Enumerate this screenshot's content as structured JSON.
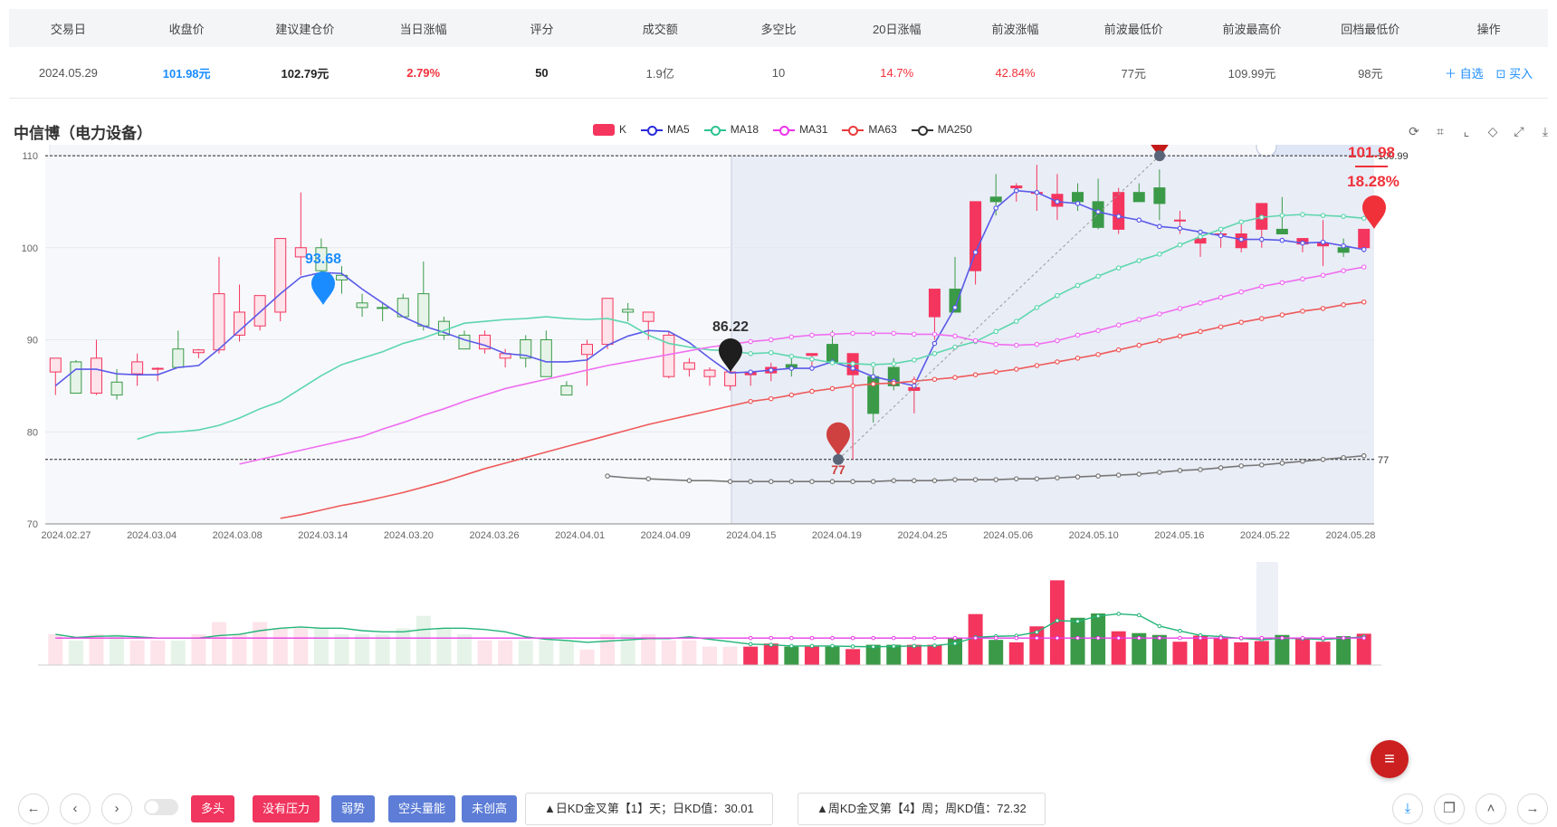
{
  "table": {
    "headers": [
      "交易日",
      "收盘价",
      "建议建仓价",
      "当日涨幅",
      "评分",
      "成交额",
      "多空比",
      "20日涨幅",
      "前波涨幅",
      "前波最低价",
      "前波最高价",
      "回档最低价",
      "操作"
    ],
    "row": [
      "2024.05.29",
      "101.98元",
      "102.79元",
      "2.79%",
      "50",
      "1.9亿",
      "10",
      "14.7%",
      "42.84%",
      "77元",
      "109.99元",
      "98元"
    ],
    "actions": {
      "watch": "＋ 自选",
      "buy": "买入"
    }
  },
  "chart": {
    "title": "中信博（电力设备）",
    "legend": [
      {
        "name": "K",
        "color": "#f4355e"
      },
      {
        "name": "MA5",
        "color": "#2b2bd9"
      },
      {
        "name": "MA18",
        "color": "#2dc391"
      },
      {
        "name": "MA31",
        "color": "#ee33ee"
      },
      {
        "name": "MA63",
        "color": "#e83b3b"
      },
      {
        "name": "MA250",
        "color": "#333333"
      }
    ],
    "tools": [
      "refresh-icon",
      "zoom-select-icon",
      "zoom-reset-icon",
      "restore-icon",
      "fullscreen-icon",
      "save-image-icon"
    ]
  },
  "chart_data": {
    "type": "candlestick",
    "title": "中信博（电力设备）",
    "ylim": [
      70,
      110
    ],
    "y_ticks": [
      "110",
      "100",
      "90",
      "80",
      "70"
    ],
    "x_ticks": [
      "2024.02.27",
      "2024.03.04",
      "2024.03.08",
      "2024.03.14",
      "2024.03.20",
      "2024.03.26",
      "2024.04.01",
      "2024.04.09",
      "2024.04.15",
      "2024.04.19",
      "2024.04.25",
      "2024.05.06",
      "2024.05.10",
      "2024.05.16",
      "2024.05.22",
      "2024.05.28"
    ],
    "annotations": {
      "high_marker": "109.99",
      "low_marker": "77",
      "marker_a": "93.68",
      "marker_b": "86.22",
      "last_price": "101.98",
      "last_change": "18.28%",
      "right_high_label": "109.99",
      "right_low_label": "77"
    },
    "candles_ohlc": [
      [
        86.5,
        88,
        84,
        88
      ],
      [
        87.6,
        87.8,
        85,
        84.2
      ],
      [
        84.2,
        90,
        84,
        88
      ],
      [
        85.4,
        86.8,
        83.5,
        84
      ],
      [
        86.3,
        88.5,
        85,
        87.6
      ],
      [
        86.8,
        87,
        85.5,
        86.9
      ],
      [
        89,
        91,
        87.5,
        87
      ],
      [
        88.6,
        89,
        88,
        88.9
      ],
      [
        88.9,
        99,
        88.5,
        95
      ],
      [
        90.5,
        96,
        89.8,
        93
      ],
      [
        91.5,
        94,
        91,
        94.8
      ],
      [
        93,
        101,
        92,
        101
      ],
      [
        99,
        106,
        97,
        100
      ],
      [
        100,
        101,
        97,
        97.5
      ],
      [
        97,
        98,
        95,
        96.5
      ],
      [
        94,
        95,
        92.5,
        93.5
      ],
      [
        93.5,
        94,
        92,
        93.4
      ],
      [
        94.5,
        95,
        93,
        92.5
      ],
      [
        95,
        98.5,
        91,
        91.5
      ],
      [
        92,
        92.5,
        90,
        90.5
      ],
      [
        90.5,
        91,
        89,
        89
      ],
      [
        89,
        91,
        88.5,
        90.5
      ],
      [
        88,
        89,
        87,
        88.5
      ],
      [
        90,
        90.5,
        87,
        88
      ],
      [
        90,
        91,
        87.5,
        86
      ],
      [
        85,
        85.5,
        84,
        84
      ],
      [
        88.4,
        90,
        85,
        89.5
      ],
      [
        89.5,
        94,
        89,
        94.5
      ],
      [
        93.3,
        94,
        92,
        93
      ],
      [
        92,
        93,
        90,
        93
      ],
      [
        86,
        91,
        85.8,
        90.5
      ],
      [
        86.8,
        88,
        86,
        87.5
      ],
      [
        86,
        87,
        85,
        86.7
      ],
      [
        85,
        87.5,
        84.5,
        86.5
      ],
      [
        86.2,
        86.5,
        85,
        86.5
      ],
      [
        86.4,
        87.5,
        85.5,
        87
      ],
      [
        87.3,
        88,
        86,
        87
      ],
      [
        88.3,
        88.5,
        87,
        88.5
      ],
      [
        89.5,
        91,
        88.5,
        87.5
      ],
      [
        86.2,
        88,
        77,
        88.5
      ],
      [
        86,
        87,
        81,
        82
      ],
      [
        87,
        88,
        84.5,
        85
      ],
      [
        84.5,
        86,
        82,
        84.8
      ],
      [
        92.5,
        95,
        90,
        95.5
      ],
      [
        95.5,
        99,
        94,
        93
      ],
      [
        97.5,
        105,
        96,
        105
      ],
      [
        105.5,
        108,
        103.5,
        105
      ],
      [
        106.5,
        107,
        105,
        106.7
      ],
      [
        106,
        109,
        104,
        106
      ],
      [
        104.5,
        108,
        103,
        105.8
      ],
      [
        106,
        107,
        104,
        105
      ],
      [
        105,
        107.5,
        102,
        102.2
      ],
      [
        102,
        106.5,
        101.5,
        106
      ],
      [
        106,
        107,
        105,
        105
      ],
      [
        106.5,
        108.5,
        103,
        104.8
      ],
      [
        103,
        104,
        101.5,
        103
      ],
      [
        100.5,
        101,
        99,
        101
      ],
      [
        101.5,
        102,
        100,
        101.5
      ],
      [
        100,
        102.5,
        99.5,
        101.5
      ],
      [
        102,
        104.5,
        100,
        104.8
      ],
      [
        102,
        105.5,
        101.5,
        101.5
      ],
      [
        100.4,
        101,
        99.5,
        101
      ],
      [
        100.2,
        103,
        98,
        100.5
      ],
      [
        100,
        101,
        99,
        99.5
      ],
      [
        100,
        102,
        99.5,
        102
      ]
    ],
    "series": [
      {
        "name": "MA5",
        "values": [
          85,
          86.8,
          86.8,
          86.3,
          86.2,
          86.2,
          87,
          87.2,
          89,
          91,
          93,
          95,
          96.8,
          97.3,
          97.2,
          95.5,
          94,
          92.5,
          91.5,
          90.8,
          90,
          89.4,
          88.5,
          88.3,
          87.6,
          87.6,
          87.8,
          89.4,
          90.4,
          91,
          90.9,
          89.7,
          88,
          86.4,
          86.5,
          86.7,
          86.9,
          86.9,
          87.6,
          86.9,
          86,
          85.5,
          85,
          89.6,
          93.5,
          99.5,
          104.3,
          106.2,
          106,
          105,
          104.8,
          103.9,
          103.4,
          103,
          102.3,
          102.1,
          101.7,
          101.3,
          100.9,
          100.9,
          100.8,
          100.5,
          100.6,
          100.2,
          99.8
        ]
      },
      {
        "name": "MA18",
        "values": [
          79.2,
          79.9,
          80,
          80.2,
          80.7,
          81.5,
          82.5,
          83.3,
          84.7,
          86.1,
          87.3,
          88,
          88.7,
          89.6,
          90.2,
          91,
          91.8,
          92,
          92.2,
          92.3,
          92.5,
          92.3,
          92.2,
          92.3,
          91.8,
          90.5,
          89.6,
          89.2,
          88.9,
          88.8,
          88.5,
          88.6,
          88.2,
          87.9,
          87.5,
          87.4,
          87.3,
          87.4,
          87.8,
          88.5,
          89.2,
          89.8,
          90.9,
          92,
          93.5,
          94.8,
          95.9,
          96.9,
          97.8,
          98.6,
          99.3,
          100.3,
          101.2,
          102,
          102.8,
          103.3,
          103.5,
          103.6,
          103.5,
          103.4,
          103.2
        ]
      },
      {
        "name": "MA31",
        "values": [
          76.5,
          77,
          77.5,
          78,
          78.5,
          79,
          79.5,
          80.3,
          81,
          81.8,
          82.5,
          83.3,
          84,
          84.7,
          85.2,
          85.7,
          86.2,
          86.7,
          87.2,
          87.6,
          88,
          88.4,
          88.8,
          89.2,
          89.5,
          89.8,
          90,
          90.3,
          90.5,
          90.6,
          90.7,
          90.7,
          90.7,
          90.6,
          90.6,
          90.4,
          89.9,
          89.5,
          89.4,
          89.5,
          89.9,
          90.5,
          91,
          91.6,
          92.2,
          92.8,
          93.4,
          94,
          94.6,
          95.2,
          95.8,
          96.2,
          96.6,
          97,
          97.5,
          97.9
        ]
      },
      {
        "name": "MA63",
        "values": [
          70.6,
          71,
          71.5,
          72,
          72.4,
          72.9,
          73.4,
          74,
          74.6,
          75.3,
          76,
          76.6,
          77.2,
          77.8,
          78.4,
          79,
          79.6,
          80.2,
          80.8,
          81.3,
          81.8,
          82.3,
          82.8,
          83.3,
          83.6,
          84,
          84.4,
          84.7,
          85,
          85.2,
          85.3,
          85.5,
          85.7,
          85.9,
          86.2,
          86.5,
          86.8,
          87.2,
          87.6,
          88,
          88.4,
          88.9,
          89.4,
          89.9,
          90.4,
          90.9,
          91.4,
          91.9,
          92.3,
          92.7,
          93.1,
          93.4,
          93.8,
          94.1
        ]
      },
      {
        "name": "MA250",
        "values": [
          75.2,
          75,
          74.9,
          74.8,
          74.7,
          74.7,
          74.6,
          74.6,
          74.6,
          74.6,
          74.6,
          74.6,
          74.6,
          74.6,
          74.7,
          74.7,
          74.7,
          74.8,
          74.8,
          74.8,
          74.9,
          74.9,
          75,
          75.1,
          75.2,
          75.3,
          75.4,
          75.6,
          75.8,
          75.9,
          76.1,
          76.3,
          76.4,
          76.6,
          76.8,
          77,
          77.2,
          77.4
        ]
      }
    ],
    "volume_colors_note": "red=up green=down",
    "volume": [
      5,
      4,
      5,
      5,
      4,
      4,
      4,
      5,
      7,
      5,
      7,
      6,
      6,
      6,
      5,
      5,
      5,
      6,
      8,
      6,
      5,
      4,
      4,
      4,
      4,
      4,
      2.5,
      5,
      5,
      5,
      4,
      4,
      3,
      3,
      3,
      3.5,
      3,
      3,
      3,
      2.6,
      3.3,
      3.3,
      3.3,
      3.3,
      4.4,
      8.3,
      4.1,
      3.7,
      6.3,
      13.8,
      7.7,
      8.4,
      5.5,
      5.2,
      4.9,
      3.8,
      4.8,
      4.5,
      3.7,
      3.9,
      4.9,
      4.5,
      3.8,
      4.7,
      5.1
    ]
  },
  "buttons": {
    "bull": "多头",
    "no_pressure": "没有压力",
    "weak": "弱势",
    "bear_volume": "空头量能",
    "no_new_high": "未创高",
    "daily_kd": "▲日KD金叉第【1】天；日KD值：30.01",
    "weekly_kd": "▲周KD金叉第【4】周；周KD值：72.32"
  },
  "colors": {
    "up": "#f4355e",
    "down": "#3a9a48",
    "accent": "#1a8cff",
    "tag_red": "#f0355e",
    "tag_blue": "#5d7dd6"
  }
}
